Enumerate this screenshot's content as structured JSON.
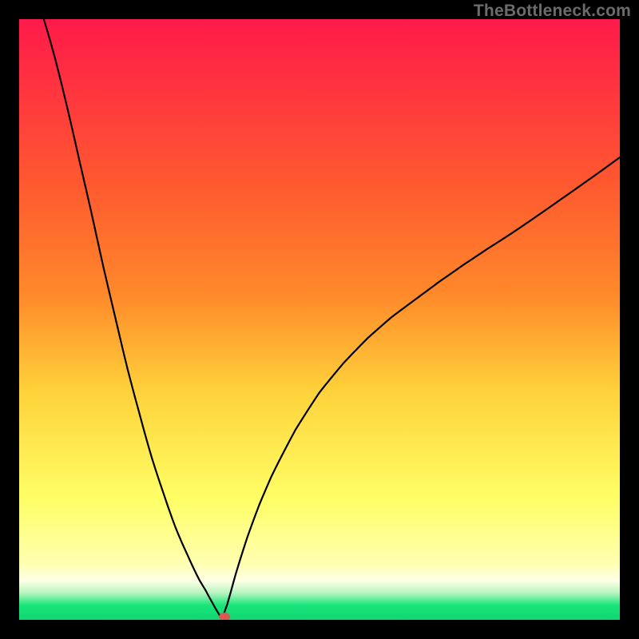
{
  "watermark": "TheBottleneck.com",
  "colors": {
    "top": "#ff1a4a",
    "mid_upper": "#ff8a2a",
    "mid": "#ffd23a",
    "mid_lower": "#ffff66",
    "whitish": "#fdffe5",
    "green": "#19e67b",
    "black": "#000000"
  },
  "chart_data": {
    "type": "line",
    "title": "",
    "xlabel": "",
    "ylabel": "",
    "xlim": [
      0,
      100
    ],
    "ylim": [
      0,
      100
    ],
    "x_min_value": 34,
    "marker": {
      "x": 34.2,
      "y": 0.5,
      "color": "#d85a52"
    },
    "left_curve_sharpening_exp": 4.0,
    "right_curve_sharpening_exp": 2.6,
    "right_curve_end_y": 77,
    "series": [
      {
        "name": "bottleneck-curve",
        "x": [
          4.1,
          6,
          8,
          10,
          12,
          14,
          16,
          18,
          20,
          22,
          24,
          26,
          28,
          30,
          31,
          32,
          32.8,
          33.4,
          34.0,
          34.6,
          35.2,
          36,
          37,
          38,
          40,
          42,
          44,
          46,
          48,
          50,
          54,
          58,
          62,
          66,
          70,
          74,
          78,
          82,
          86,
          90,
          94,
          98,
          100
        ],
        "values": [
          100,
          94,
          87,
          80,
          74,
          67,
          61,
          54,
          48,
          41,
          35,
          28,
          22,
          15,
          12,
          8,
          4.5,
          2,
          0.5,
          0.5,
          2.5,
          6,
          10,
          14,
          21,
          27,
          32,
          37,
          41,
          45,
          51,
          56,
          60,
          63,
          66,
          68.5,
          70.5,
          72,
          73.5,
          74.8,
          75.8,
          76.6,
          77
        ]
      }
    ]
  }
}
